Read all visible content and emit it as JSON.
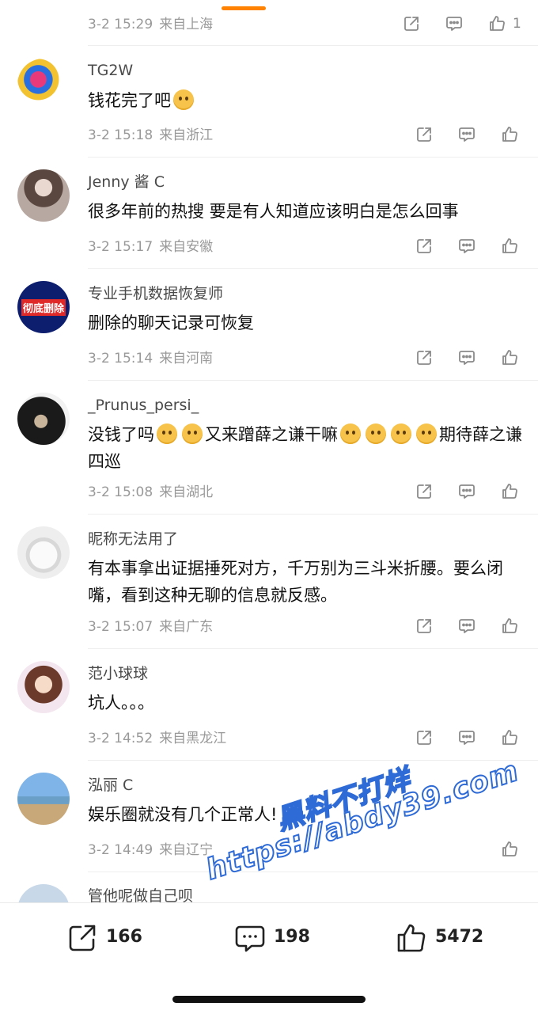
{
  "comments": [
    {
      "user": "",
      "text": "",
      "date": "3-2 15:29",
      "location": "来自上海",
      "likes": "1"
    },
    {
      "user": "TG2W",
      "text": "钱花完了吧",
      "date": "3-2 15:18",
      "location": "来自浙江",
      "likes": ""
    },
    {
      "user": "Jenny 酱 C",
      "text": "很多年前的热搜 要是有人知道应该明白是怎么回事",
      "date": "3-2 15:17",
      "location": "来自安徽",
      "likes": ""
    },
    {
      "user": "专业手机数据恢复师",
      "text": "删除的聊天记录可恢复",
      "date": "3-2 15:14",
      "location": "来自河南",
      "likes": ""
    },
    {
      "user": "_Prunus_persi_",
      "text_parts": [
        "没钱了吗",
        "又来蹭薛之谦干嘛",
        "期待薛之谦四巡"
      ],
      "date": "3-2 15:08",
      "location": "来自湖北",
      "likes": ""
    },
    {
      "user": "昵称无法用了",
      "text": "有本事拿出证据捶死对方，千万别为三斗米折腰。要么闭嘴，看到这种无聊的信息就反感。",
      "date": "3-2 15:07",
      "location": "来自广东",
      "likes": ""
    },
    {
      "user": "范小球球",
      "text": "坑人。。。",
      "date": "3-2 14:52",
      "location": "来自黑龙江",
      "likes": ""
    },
    {
      "user": "泓丽 C",
      "text": "娱乐圈就没有几个正常人!",
      "date": "3-2 14:49",
      "location": "来自辽宁",
      "likes": ""
    },
    {
      "user": "管他呢做自己呗",
      "text": "",
      "date": "",
      "location": "",
      "likes": ""
    }
  ],
  "avatar4_text": "彻底删除",
  "bottom": {
    "share": "166",
    "comment": "198",
    "like": "5472"
  },
  "watermark": {
    "line1": "黑料不打烊",
    "line2": "https://abdy39.com"
  },
  "colors": {
    "accent": "#ff8200",
    "watermark_stroke": "#2f6bd6"
  },
  "icons": {
    "share": "share-icon",
    "comment": "comment-icon",
    "like": "like-icon"
  }
}
